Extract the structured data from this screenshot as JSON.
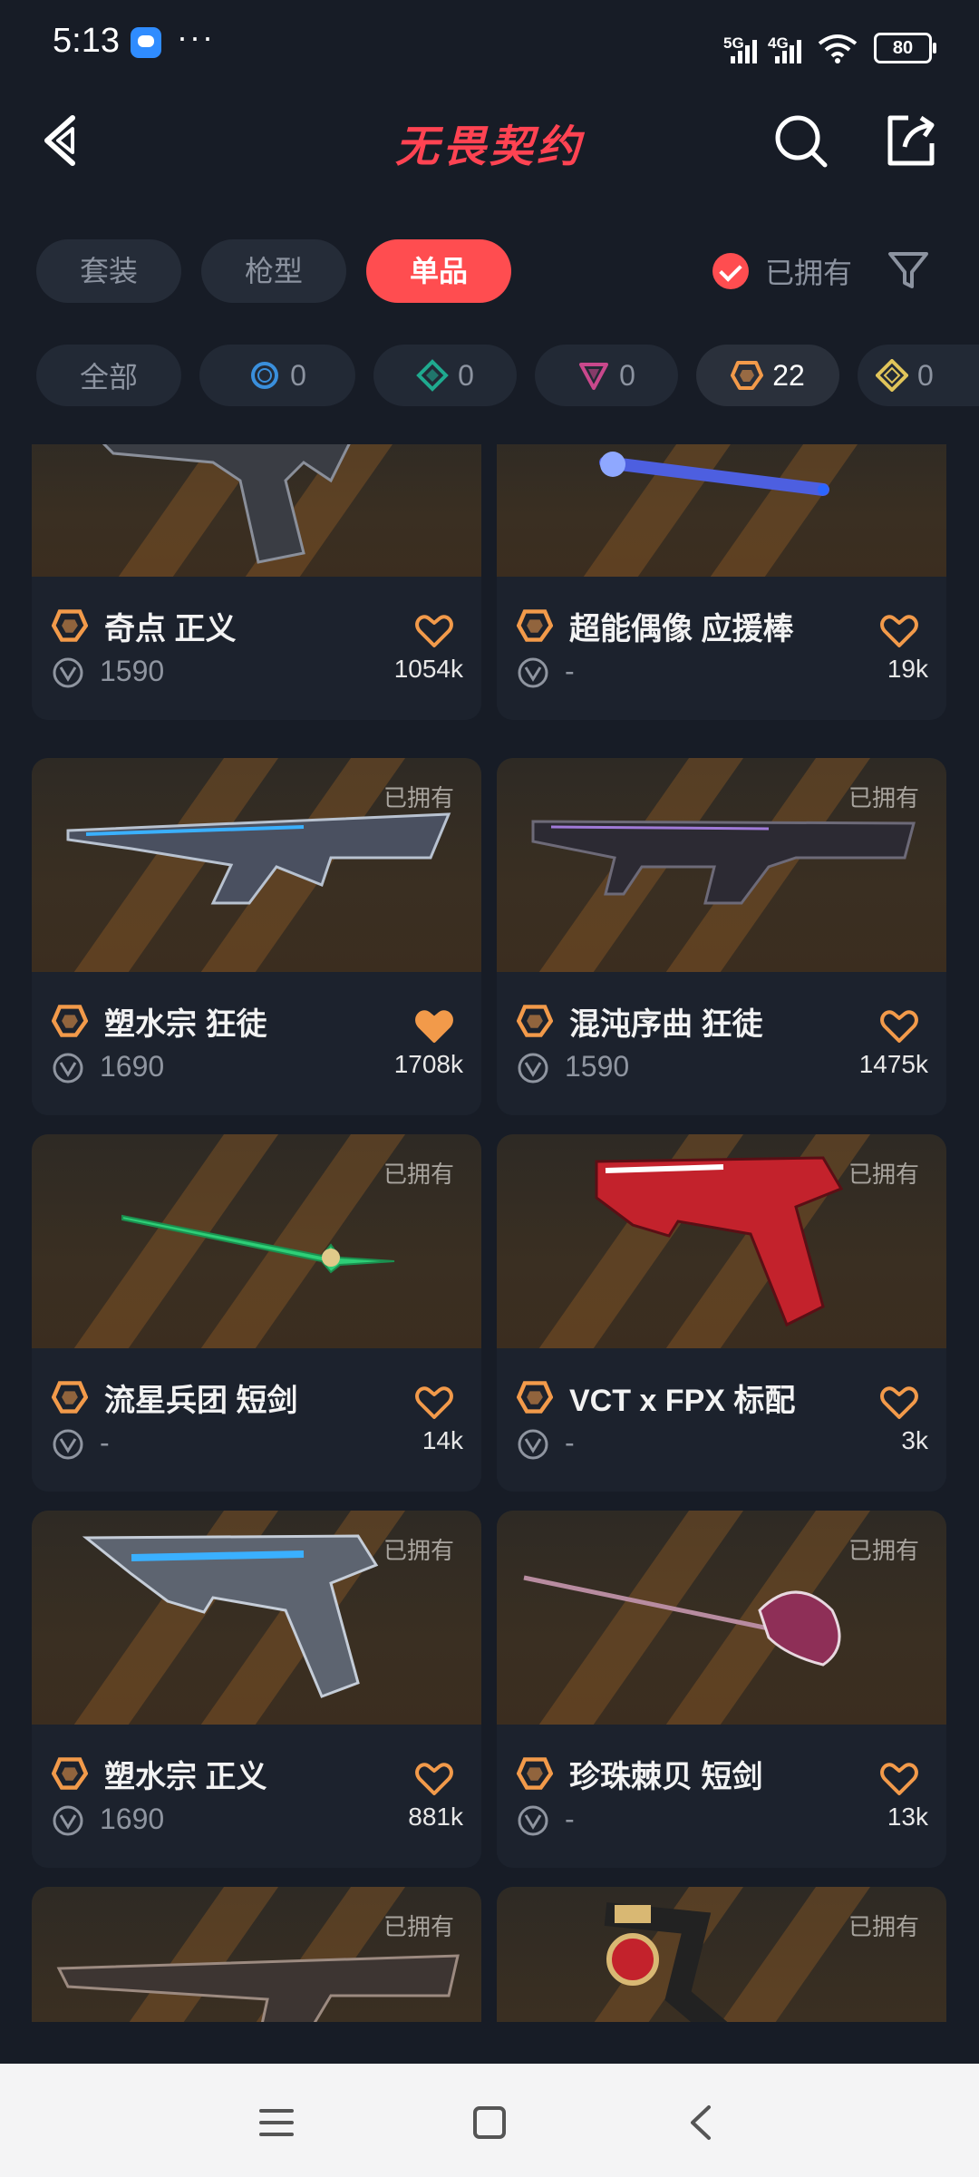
{
  "status_bar": {
    "time": "5:13",
    "dots": "···",
    "sig1": "5G",
    "sig2": "4G",
    "battery": "80"
  },
  "header": {
    "title": "无畏契约"
  },
  "tabs": [
    {
      "label": "套装",
      "active": false
    },
    {
      "label": "枪型",
      "active": false
    },
    {
      "label": "单品",
      "active": true
    }
  ],
  "owned_filter": {
    "label": "已拥有",
    "checked": true
  },
  "chips": [
    {
      "label": "全部",
      "icon": "all"
    },
    {
      "label": "0",
      "icon": "select-tier-icon",
      "color": "#3a8fdc"
    },
    {
      "label": "0",
      "icon": "deluxe-tier-icon",
      "color": "#1faa8f"
    },
    {
      "label": "0",
      "icon": "premium-tier-icon",
      "color": "#c9488c"
    },
    {
      "label": "22",
      "icon": "exclusive-tier-icon",
      "color": "#f29a4a",
      "active": true
    },
    {
      "label": "0",
      "icon": "ultra-tier-icon",
      "color": "#e0c45a"
    }
  ],
  "items": [
    {
      "name": "奇点 正义",
      "price": "1590",
      "likes": "1054k",
      "owned": false,
      "owned_label": "",
      "liked": false
    },
    {
      "name": "超能偶像 应援棒",
      "price": "-",
      "likes": "19k",
      "owned": false,
      "owned_label": "",
      "liked": false
    },
    {
      "name": "塑水宗 狂徒",
      "price": "1690",
      "likes": "1708k",
      "owned": true,
      "owned_label": "已拥有",
      "liked": true
    },
    {
      "name": "混沌序曲 狂徒",
      "price": "1590",
      "likes": "1475k",
      "owned": true,
      "owned_label": "已拥有",
      "liked": false
    },
    {
      "name": "流星兵团 短剑",
      "price": "-",
      "likes": "14k",
      "owned": true,
      "owned_label": "已拥有",
      "liked": false
    },
    {
      "name": "VCT x FPX 标配",
      "price": "-",
      "likes": "3k",
      "owned": true,
      "owned_label": "已拥有",
      "liked": false
    },
    {
      "name": "塑水宗 正义",
      "price": "1690",
      "likes": "881k",
      "owned": true,
      "owned_label": "已拥有",
      "liked": false
    },
    {
      "name": "珍珠棘贝 短剑",
      "price": "-",
      "likes": "13k",
      "owned": true,
      "owned_label": "已拥有",
      "liked": false
    },
    {
      "name": "",
      "price": "",
      "likes": "",
      "owned": true,
      "owned_label": "已拥有",
      "liked": false
    },
    {
      "name": "",
      "price": "",
      "likes": "",
      "owned": true,
      "owned_label": "已拥有",
      "liked": false
    }
  ],
  "colors": {
    "accent": "#ff4d50",
    "background": "#171c26",
    "card": "#1c222d",
    "exclusive": "#f29a4a",
    "heart": "#f29a4a"
  }
}
